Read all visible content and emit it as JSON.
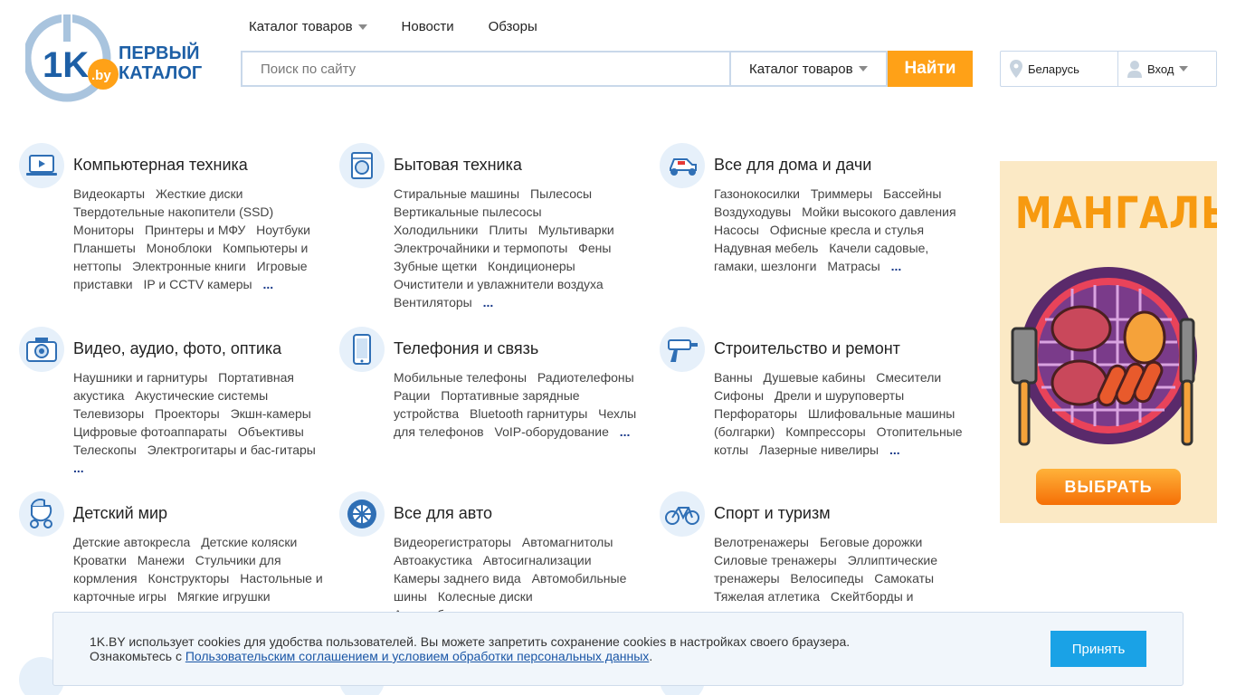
{
  "header": {
    "logo": {
      "badge": "1K",
      "badge_domain": ".by",
      "line1": "ПЕРВЫЙ",
      "line2": "КАТАЛОГ"
    },
    "nav": [
      "Каталог товаров",
      "Новости",
      "Обзоры"
    ],
    "search": {
      "placeholder": "Поиск по сайту",
      "scope": "Каталог товаров",
      "button": "Найти"
    },
    "region": "Беларусь",
    "login": "Вход"
  },
  "colors": {
    "accent": "#ffa117",
    "link_more": "#1a3a8a",
    "icon_bg": "#e6f0fa",
    "cookie_button": "#1aa2e6"
  },
  "categories": [
    {
      "title": "Компьютерная техника",
      "icon": "laptop-icon",
      "links": [
        "Видеокарты",
        "Жесткие диски",
        "Твердотельные накопители (SSD)",
        "Мониторы",
        "Принтеры и МФУ",
        "Ноутбуки",
        "Планшеты",
        "Моноблоки",
        "Компьютеры и неттопы",
        "Электронные книги",
        "Игровые приставки",
        "IP и CCTV камеры"
      ],
      "more": "..."
    },
    {
      "title": "Бытовая техника",
      "icon": "washing-machine-icon",
      "links": [
        "Стиральные машины",
        "Пылесосы",
        "Вертикальные пылесосы",
        "Холодильники",
        "Плиты",
        "Мультиварки",
        "Электрочайники и термопоты",
        "Фены",
        "Зубные щетки",
        "Кондиционеры",
        "Очистители и увлажнители воздуха",
        "Вентиляторы"
      ],
      "more": "..."
    },
    {
      "title": "Все для дома и дачи",
      "icon": "lawn-mower-icon",
      "links": [
        "Газонокосилки",
        "Триммеры",
        "Бассейны",
        "Воздуходувы",
        "Мойки высокого давления",
        "Насосы",
        "Офисные кресла и стулья",
        "Надувная мебель",
        "Качели садовые, гамаки, шезлонги",
        "Матрасы"
      ],
      "more": "..."
    },
    {
      "title": "Видео, аудио, фото, оптика",
      "icon": "camera-icon",
      "links": [
        "Наушники и гарнитуры",
        "Портативная акустика",
        "Акустические системы",
        "Телевизоры",
        "Проекторы",
        "Экшн-камеры",
        "Цифровые фотоаппараты",
        "Объективы",
        "Телескопы",
        "Электрогитары и бас-гитары"
      ],
      "more": "..."
    },
    {
      "title": "Телефония и связь",
      "icon": "smartphone-icon",
      "links": [
        "Мобильные телефоны",
        "Радиотелефоны",
        "Рации",
        "Портативные зарядные устройства",
        "Bluetooth гарнитуры",
        "Чехлы для телефонов",
        "VoIP-оборудование"
      ],
      "more": "..."
    },
    {
      "title": "Строительство и ремонт",
      "icon": "drill-icon",
      "links": [
        "Ванны",
        "Душевые кабины",
        "Смесители",
        "Сифоны",
        "Дрели и шуруповерты",
        "Перфораторы",
        "Шлифовальные машины (болгарки)",
        "Компрессоры",
        "Отопительные котлы",
        "Лазерные нивелиры"
      ],
      "more": "..."
    },
    {
      "title": "Детский мир",
      "icon": "stroller-icon",
      "links": [
        "Детские автокресла",
        "Детские коляски",
        "Кроватки",
        "Манежи",
        "Стульчики для кормления",
        "Конструкторы",
        "Настольные и карточные игры",
        "Мягкие игрушки"
      ],
      "more": ""
    },
    {
      "title": "Все для авто",
      "icon": "car-wheel-icon",
      "links": [
        "Видеорегистраторы",
        "Автомагнитолы",
        "Автоакустика",
        "Автосигнализации",
        "Камеры заднего вида",
        "Автомобильные шины",
        "Колесные диски",
        "Автомобильные"
      ],
      "more": ""
    },
    {
      "title": "Спорт и туризм",
      "icon": "bicycle-icon",
      "links": [
        "Велотренажеры",
        "Беговые дорожки",
        "Силовые тренажеры",
        "Эллиптические тренажеры",
        "Велосипеды",
        "Самокаты",
        "Тяжелая атлетика",
        "Скейтборды и"
      ],
      "more": ""
    }
  ],
  "banner": {
    "title": "МАНГАЛЫ",
    "button": "ВЫБРАТЬ"
  },
  "cookie": {
    "line1": "1K.BY использует cookies для удобства пользователей. Вы можете запретить сохранение cookies в настройках своего браузера.",
    "line2_prefix": "Ознакомьтесь с ",
    "link": "Пользовательским соглашением и условием обработки персональных данных",
    "line2_suffix": ".",
    "button": "Принять"
  }
}
